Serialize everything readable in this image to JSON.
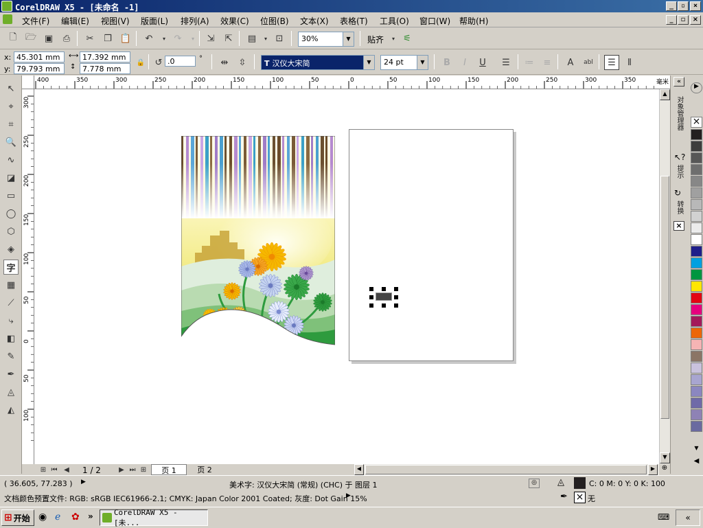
{
  "window": {
    "title": "CorelDRAW X5 - [未命名 -1]"
  },
  "menu": [
    "文件(F)",
    "编辑(E)",
    "视图(V)",
    "版面(L)",
    "排列(A)",
    "效果(C)",
    "位图(B)",
    "文本(X)",
    "表格(T)",
    "工具(O)",
    "窗口(W)",
    "帮助(H)"
  ],
  "toolbar": {
    "zoom": "30%",
    "snap_label": "贴齐"
  },
  "property_bar": {
    "x_label": "x:",
    "x": "45.301 mm",
    "y_label": "y:",
    "y": "79.793 mm",
    "width": "17.392 mm",
    "height": "7.778 mm",
    "rotation": ".0",
    "rotation_unit": "°",
    "font_name": "汉仪大宋简",
    "font_size": "24 pt",
    "bold": "B",
    "italic": "I",
    "underline": "U"
  },
  "hruler_labels": [
    "400",
    "350",
    "300",
    "250",
    "200",
    "150",
    "100",
    "50",
    "0",
    "50",
    "100",
    "150",
    "200",
    "250",
    "300",
    "350"
  ],
  "hruler_unit": "毫米",
  "vruler_labels": [
    "300",
    "250",
    "200",
    "150",
    "100",
    "50",
    "0",
    "50",
    "100"
  ],
  "page_nav": {
    "count": "1 / 2",
    "tabs": [
      "页 1",
      "页 2"
    ]
  },
  "docker_tabs": [
    "对象管理器",
    "提示",
    "转换"
  ],
  "palette": [
    "#231f20",
    "#3d3d3d",
    "#575757",
    "#6e6e6e",
    "#878787",
    "#a0a0a0",
    "#b8b8b8",
    "#d1d1d1",
    "#ebebeb",
    "#ffffff",
    "#1e1e8a",
    "#00a0e0",
    "#009640",
    "#ffe600",
    "#e30613",
    "#e6007e",
    "#a3195b",
    "#ec6608",
    "#f5b4b4",
    "#8b7566",
    "#c9c2dd",
    "#a8a5d0",
    "#8b87c0",
    "#6f6aa8",
    "#8e82b5",
    "#6a6aa0"
  ],
  "status": {
    "coords": "( 36.605, 77.283 )",
    "object_info": "美术字: 汉仪大宋简 (常规) (CHC) 于 图层 1",
    "fill_info": "C: 0 M: 0 Y: 0 K: 100",
    "outline_info": "无",
    "color_profile": "文档颜色预置文件: RGB: sRGB IEC61966-2.1; CMYK: Japan Color 2001 Coated; 灰度: Dot Gain 15%"
  },
  "taskbar": {
    "start": "开始",
    "task": "CorelDRAW X5 - [未..."
  }
}
